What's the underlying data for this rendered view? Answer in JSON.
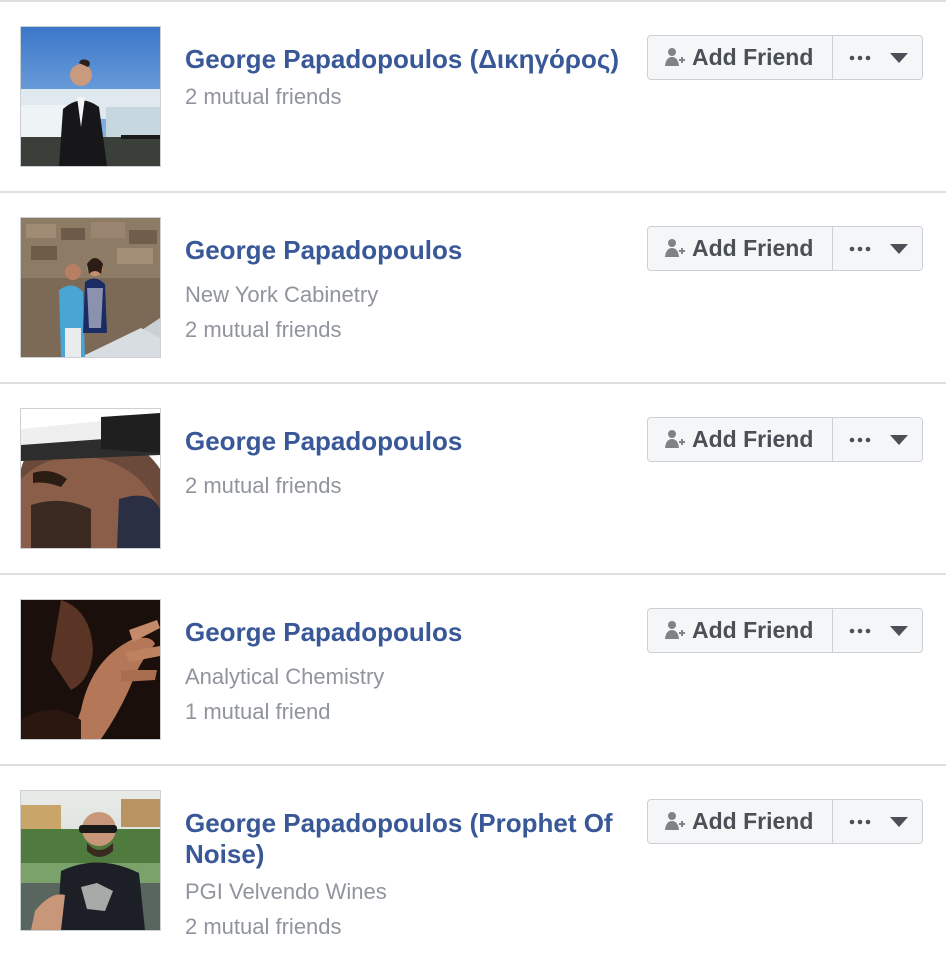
{
  "results": [
    {
      "name": "George Papadopoulos (Δικηγόρος)",
      "subtitle": "",
      "mutual": "2 mutual friends",
      "photo": "man-in-suit-at-waterfall"
    },
    {
      "name": "George Papadopoulos",
      "subtitle": "New York Cabinetry",
      "mutual": "2 mutual friends",
      "photo": "couple-on-stone-stairs"
    },
    {
      "name": "George Papadopoulos",
      "subtitle": "",
      "mutual": "2 mutual friends",
      "photo": "man-with-goggles-closeup"
    },
    {
      "name": "George Papadopoulos",
      "subtitle": "Analytical Chemistry",
      "mutual": "1 mutual friend",
      "photo": "hand-gesture-dark"
    },
    {
      "name": "George Papadopoulos (Prophet Of Noise)",
      "subtitle": "PGI Velvendo Wines",
      "mutual": "2 mutual friends",
      "photo": "bald-man-sunglasses-outdoors"
    }
  ],
  "buttons": {
    "add_friend_label": "Add Friend",
    "add_friend_icon": "add-friend-icon",
    "more_icon": "more-dots-icon",
    "dropdown_icon": "chevron-down-icon"
  },
  "colors": {
    "name_link": "#385898",
    "secondary_text": "#90949c",
    "button_bg": "#f5f6f7",
    "button_border": "#ccd0d5",
    "button_text": "#4b4f56",
    "divider": "#dddfe2"
  }
}
